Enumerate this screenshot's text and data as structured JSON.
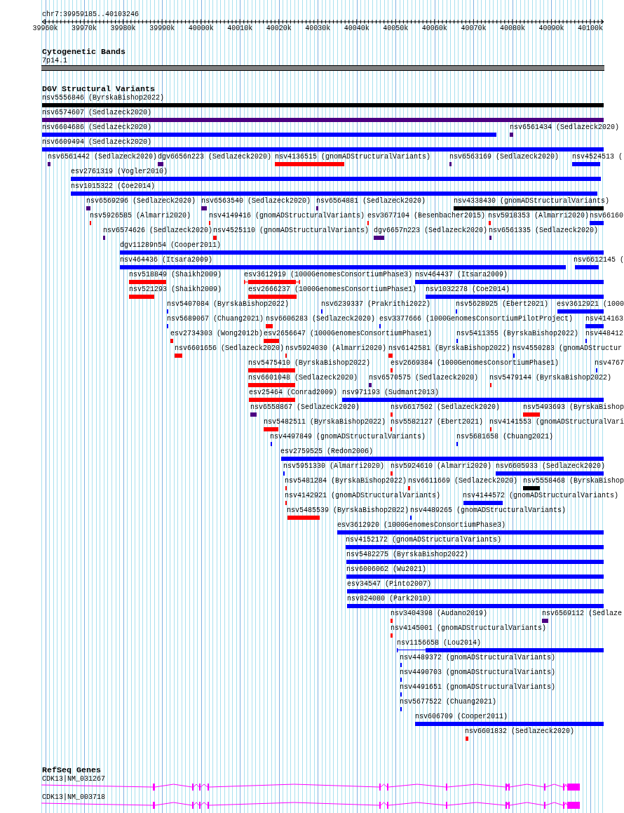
{
  "ruler": {
    "location": "chr7:39959185..40103246",
    "ticks": [
      "39960k",
      "39970k",
      "39980k",
      "39990k",
      "40000k",
      "40010k",
      "40020k",
      "40030k",
      "40040k",
      "40050k",
      "40060k",
      "40070k",
      "40080k",
      "40090k",
      "40100k"
    ]
  },
  "cytogenetic_bands": {
    "title": "Cytogenetic Bands",
    "band": "7p14.1"
  },
  "dgv_structural_variants": {
    "title": "DGV Structural Variants",
    "rows": [
      {
        "features": [
          {
            "label": "nsv5556846 (ByrskaBishop2022)",
            "color": "#000000",
            "kind": "bar"
          }
        ]
      },
      {
        "features": [
          {
            "label": "nsv6574607 (Sedlazeck2020)",
            "color": "#4b0082",
            "kind": "bar"
          }
        ]
      },
      {
        "features": [
          {
            "label": "nsv6604686 (Sedlazeck2020)",
            "color": "#0000ff",
            "kind": "bar"
          },
          {
            "label": "nsv6561434 (Sedlazeck2020)",
            "color": "#4b0082",
            "kind": "bar"
          }
        ]
      },
      {
        "features": [
          {
            "label": "nsv6609494 (Sedlazeck2020)",
            "color": "#0000ff",
            "kind": "bar"
          }
        ]
      },
      {
        "features": [
          {
            "label": "nsv6561442 (Sedlazeck2020)",
            "color": "#4b0082",
            "kind": "bar"
          },
          {
            "label": "dgv6656n223 (Sedlazeck2020)",
            "color": "#4b0082",
            "kind": "bar"
          },
          {
            "label": "nsv4136515 (gnomADStructuralVariants)",
            "color": "#ff0000",
            "kind": "bar"
          },
          {
            "label": "nsv6563169 (Sedlazeck2020)",
            "color": "#4b0082",
            "kind": "bar"
          },
          {
            "label": "nsv4524513 (",
            "color": "#0000ff",
            "kind": "bar"
          }
        ]
      },
      {
        "features": [
          {
            "label": "esv2761319 (Vogler2010)",
            "color": "#0000ff",
            "kind": "bar"
          }
        ]
      },
      {
        "features": [
          {
            "label": "nsv1015322 (Coe2014)",
            "color": "#0000ff",
            "kind": "bar"
          }
        ]
      },
      {
        "features": [
          {
            "label": "nsv6569296 (Sedlazeck2020)",
            "color": "#4b0082",
            "kind": "bar"
          },
          {
            "label": "nsv6563540 (Sedlazeck2020)",
            "color": "#4b0082",
            "kind": "bar"
          },
          {
            "label": "nsv6564881 (Sedlazeck2020)",
            "color": "#4b0082",
            "kind": "bar"
          },
          {
            "label": "nsv4338430 (gnomADStructuralVariants)",
            "color": "#000000",
            "kind": "bar"
          }
        ]
      },
      {
        "features": [
          {
            "label": "nsv5926585 (Almarri2020)",
            "color": "#ff0000",
            "kind": "bar"
          },
          {
            "label": "nsv4149416 (gnomADStructuralVariants)",
            "color": "#ff0000",
            "kind": "bar"
          },
          {
            "label": "esv3677104 (Besenbacher2015)",
            "color": "#ff0000",
            "kind": "bar"
          },
          {
            "label": "nsv5918353 (Almarri2020)",
            "color": "#ff0000",
            "kind": "bar"
          },
          {
            "label": "nsv66160",
            "color": "#0000ff",
            "kind": "bar"
          }
        ]
      },
      {
        "features": [
          {
            "label": "nsv6574626 (Sedlazeck2020)",
            "color": "#4b0082",
            "kind": "bar"
          },
          {
            "label": "nsv4525110 (gnomADStructuralVariants)",
            "color": "#ff0000",
            "kind": "bar"
          },
          {
            "label": "dgv6657n223 (Sedlazeck2020)",
            "color": "#4b0082",
            "kind": "bar"
          },
          {
            "label": "nsv6561335 (Sedlazeck2020)",
            "color": "#4b0082",
            "kind": "bar"
          }
        ]
      },
      {
        "features": [
          {
            "label": "dgv11289n54 (Cooper2011)",
            "color": "#0000ff",
            "kind": "bar"
          }
        ]
      },
      {
        "features": [
          {
            "label": "nsv464436 (Itsara2009)",
            "color": "#0000ff",
            "kind": "bar"
          },
          {
            "label": "nsv6612145 (",
            "color": "#0000ff",
            "kind": "bar"
          }
        ]
      },
      {
        "features": [
          {
            "label": "nsv518849 (Shaikh2009)",
            "color": "#ff0000",
            "kind": "bar"
          },
          {
            "label": "esv3612919 (1000GenomesConsortiumPhase3)",
            "color": "#ff0000",
            "kind": "whiskered_bar"
          },
          {
            "label": "nsv464437 (Itsara2009)",
            "color": "#0000ff",
            "kind": "bar"
          }
        ]
      },
      {
        "features": [
          {
            "label": "nsv521293 (Shaikh2009)",
            "color": "#ff0000",
            "kind": "bar"
          },
          {
            "label": "esv2666237 (1000GenomesConsortiumPhase1)",
            "color": "#ff0000",
            "kind": "bar"
          },
          {
            "label": "nsv1032278 (Coe2014)",
            "color": "#0000ff",
            "kind": "bar"
          }
        ]
      },
      {
        "features": [
          {
            "label": "nsv5407084 (ByrskaBishop2022)",
            "color": "#0000ff",
            "kind": "bar"
          },
          {
            "label": "nsv6239337 (Prakrithi2022)",
            "color": "#0000ff",
            "kind": "bar"
          },
          {
            "label": "nsv5628925 (Ebert2021)",
            "color": "#0000ff",
            "kind": "bar"
          },
          {
            "label": "esv3612921 (1000",
            "color": "#0000ff",
            "kind": "bar"
          }
        ]
      },
      {
        "features": [
          {
            "label": "nsv5689067 (Chuang2021)",
            "color": "#0000ff",
            "kind": "bar"
          },
          {
            "label": "nsv6606283 (Sedlazeck2020)",
            "color": "#ff0000",
            "kind": "bar"
          },
          {
            "label": "esv3377666 (1000GenomesConsortiumPilotProject)",
            "color": "#0000ff",
            "kind": "bar"
          },
          {
            "label": "nsv414163",
            "color": "#0000ff",
            "kind": "bar"
          }
        ]
      },
      {
        "features": [
          {
            "label": "esv2734303 (Wong2012b)",
            "color": "#ff0000",
            "kind": "bar"
          },
          {
            "label": "esv2656647 (1000GenomesConsortiumPhase1)",
            "color": "#ff0000",
            "kind": "bar"
          },
          {
            "label": "nsv5411355 (ByrskaBishop2022)",
            "color": "#0000ff",
            "kind": "bar"
          },
          {
            "label": "nsv448412",
            "color": "#0000ff",
            "kind": "bar"
          }
        ]
      },
      {
        "features": [
          {
            "label": "nsv6601656 (Sedlazeck2020)",
            "color": "#ff0000",
            "kind": "bar"
          },
          {
            "label": "nsv5924030 (Almarri2020)",
            "color": "#ff0000",
            "kind": "bar"
          },
          {
            "label": "nsv6142581 (ByrskaBishop2022)",
            "color": "#ff0000",
            "kind": "bar"
          },
          {
            "label": "nsv4550283 (gnomADStructur",
            "color": "#0000ff",
            "kind": "bar"
          }
        ]
      },
      {
        "features": [
          {
            "label": "nsv5475410 (ByrskaBishop2022)",
            "color": "#ff0000",
            "kind": "bar"
          },
          {
            "label": "esv2669384 (1000GenomesConsortiumPhase1)",
            "color": "#ff0000",
            "kind": "bar"
          },
          {
            "label": "nsv4767",
            "color": "#0000ff",
            "kind": "bar"
          }
        ]
      },
      {
        "features": [
          {
            "label": "nsv6601048 (Sedlazeck2020)",
            "color": "#ff0000",
            "kind": "bar"
          },
          {
            "label": "nsv6570575 (Sedlazeck2020)",
            "color": "#4b0082",
            "kind": "bar"
          },
          {
            "label": "nsv5479144 (ByrskaBishop2022)",
            "color": "#ff0000",
            "kind": "bar"
          }
        ]
      },
      {
        "features": [
          {
            "label": "esv25464 (Conrad2009)",
            "color": "#ff0000",
            "kind": "bar"
          },
          {
            "label": "nsv971193 (Sudmant2013)",
            "color": "#0000ff",
            "kind": "bar"
          }
        ]
      },
      {
        "features": [
          {
            "label": "nsv6558867 (Sedlazeck2020)",
            "color": "#4b0082",
            "kind": "bar"
          },
          {
            "label": "nsv6617502 (Sedlazeck2020)",
            "color": "#ff0000",
            "kind": "bar"
          },
          {
            "label": "nsv5493693 (ByrskaBishop",
            "color": "#ff0000",
            "kind": "bar"
          }
        ]
      },
      {
        "features": [
          {
            "label": "nsv5482511 (ByrskaBishop2022)",
            "color": "#ff0000",
            "kind": "bar"
          },
          {
            "label": "nsv5582127 (Ebert2021)",
            "color": "#ff0000",
            "kind": "bar"
          },
          {
            "label": "nsv4141553 (gnomADStructuralVari",
            "color": "#ff0000",
            "kind": "bar"
          }
        ]
      },
      {
        "features": [
          {
            "label": "nsv4497849 (gnomADStructuralVariants)",
            "color": "#0000ff",
            "kind": "bar"
          },
          {
            "label": "nsv5681658 (Chuang2021)",
            "color": "#0000ff",
            "kind": "bar"
          }
        ]
      },
      {
        "features": [
          {
            "label": "esv2759525 (Redon2006)",
            "color": "#0000ff",
            "kind": "bar"
          }
        ]
      },
      {
        "features": [
          {
            "label": "nsv5951330 (Almarri2020)",
            "color": "#0000ff",
            "kind": "bar"
          },
          {
            "label": "nsv5924610 (Almarri2020)",
            "color": "#ff0000",
            "kind": "bar"
          },
          {
            "label": "nsv6605933 (Sedlazeck2020)",
            "color": "#0000ff",
            "kind": "bar"
          }
        ]
      },
      {
        "features": [
          {
            "label": "nsv5481284 (ByrskaBishop2022)",
            "color": "#ff0000",
            "kind": "bar"
          },
          {
            "label": "nsv6611669 (Sedlazeck2020)",
            "color": "#ff0000",
            "kind": "bar"
          },
          {
            "label": "nsv5558468 (ByrskaBishop",
            "color": "#000000",
            "kind": "bar"
          }
        ]
      },
      {
        "features": [
          {
            "label": "nsv4142921 (gnomADStructuralVariants)",
            "color": "#ff0000",
            "kind": "bar"
          },
          {
            "label": "nsv4144572 (gnomADStructuralVariants)",
            "color": "#0000ff",
            "kind": "bar"
          }
        ]
      },
      {
        "features": [
          {
            "label": "nsv5485539 (ByrskaBishop2022)",
            "color": "#ff0000",
            "kind": "bar"
          },
          {
            "label": "nsv4489265 (gnomADStructuralVariants)",
            "color": "#0000ff",
            "kind": "bar"
          }
        ]
      },
      {
        "features": [
          {
            "label": "esv3612920 (1000GenomesConsortiumPhase3)",
            "color": "#0000ff",
            "kind": "bar"
          }
        ]
      },
      {
        "features": [
          {
            "label": "nsv4152172 (gnomADStructuralVariants)",
            "color": "#0000ff",
            "kind": "bar"
          }
        ]
      },
      {
        "features": [
          {
            "label": "nsv5482275 (ByrskaBishop2022)",
            "color": "#0000ff",
            "kind": "bar"
          }
        ]
      },
      {
        "features": [
          {
            "label": "nsv6006062 (Wu2021)",
            "color": "#0000ff",
            "kind": "bar"
          }
        ]
      },
      {
        "features": [
          {
            "label": "esv34547 (Pinto2007)",
            "color": "#0000ff",
            "kind": "bar"
          }
        ]
      },
      {
        "features": [
          {
            "label": "nsv824080 (Park2010)",
            "color": "#0000ff",
            "kind": "bar"
          }
        ]
      },
      {
        "features": [
          {
            "label": "nsv3404398 (Audano2019)",
            "color": "#ff0000",
            "kind": "bar"
          },
          {
            "label": "nsv6569112 (Sedlaze",
            "color": "#4b0082",
            "kind": "bar"
          }
        ]
      },
      {
        "features": [
          {
            "label": "nsv4145001 (gnomADStructuralVariants)",
            "color": "#ff0000",
            "kind": "bar"
          }
        ]
      },
      {
        "features": [
          {
            "label": "nsv1156658 (Lou2014)",
            "color": "#0000ff",
            "kind": "line_then_bar"
          }
        ]
      },
      {
        "features": [
          {
            "label": "nsv4489372 (gnomADStructuralVariants)",
            "color": "#0000ff",
            "kind": "bar"
          }
        ]
      },
      {
        "features": [
          {
            "label": "nsv4490703 (gnomADStructuralVariants)",
            "color": "#0000ff",
            "kind": "bar"
          }
        ]
      },
      {
        "features": [
          {
            "label": "nsv4491651 (gnomADStructuralVariants)",
            "color": "#0000ff",
            "kind": "bar"
          }
        ]
      },
      {
        "features": [
          {
            "label": "nsv5677522 (Chuang2021)",
            "color": "#0000ff",
            "kind": "bar"
          }
        ]
      },
      {
        "features": [
          {
            "label": "nsv606709 (Cooper2011)",
            "color": "#0000ff",
            "kind": "bar"
          }
        ]
      },
      {
        "features": [
          {
            "label": "nsv6601832 (Sedlazeck2020)",
            "color": "#ff0000",
            "kind": "bar"
          }
        ]
      }
    ]
  },
  "refseq_genes": {
    "title": "RefSeq Genes",
    "transcripts": [
      {
        "label": "CDK13|NM_031267"
      },
      {
        "label": "CDK13|NM_003718"
      }
    ]
  }
}
